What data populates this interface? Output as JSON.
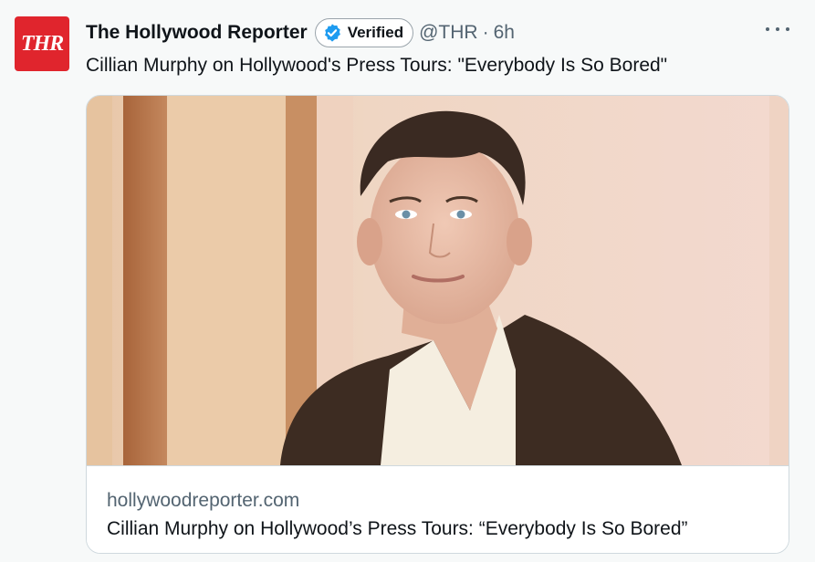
{
  "account": {
    "display_name": "The Hollywood Reporter",
    "avatar_text": "THR",
    "verified_label": "Verified",
    "handle": "@THR",
    "separator": "·",
    "time": "6h"
  },
  "tweet": {
    "text": "Cillian Murphy on Hollywood's Press Tours: \"Everybody Is So Bored\""
  },
  "card": {
    "domain": "hollywoodreporter.com",
    "title": "Cillian Murphy on Hollywood’s Press Tours: “Everybody Is So Bored”"
  },
  "icons": {
    "verified": "verified-badge-icon",
    "more": "more-options-icon"
  },
  "colors": {
    "brand_red": "#e0252d",
    "verified_blue": "#1d9bf0",
    "secondary_text": "#536471"
  }
}
